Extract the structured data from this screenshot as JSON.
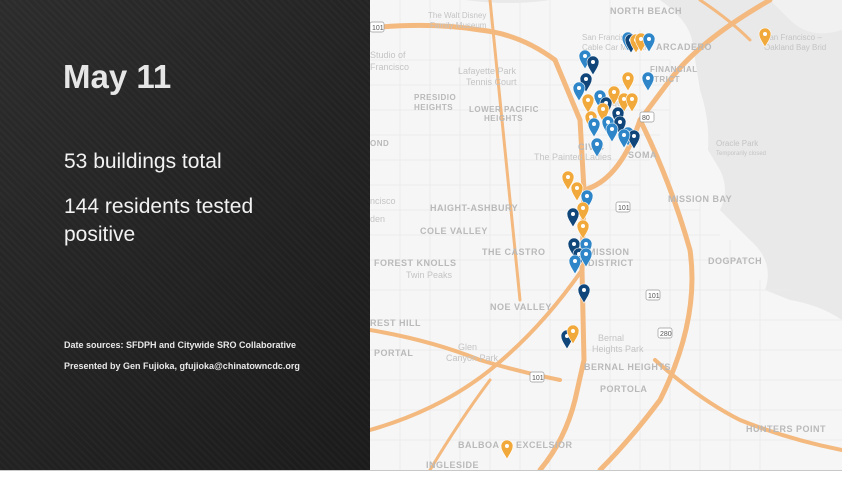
{
  "slide": {
    "title": "May 11",
    "stat_buildings": "53 buildings total",
    "stat_residents": "144 residents tested positive",
    "data_sources": "Date sources: SFDPH and Citywide SRO Collaborative",
    "presenter": "Presented by Gen Fujioka, gfujioka@chinatowncdc.org"
  },
  "map": {
    "labels": {
      "north_beach": "NORTH BEACH",
      "walt_disney": "The Walt Disney",
      "family_museum": "Family Museum",
      "studio_of": "Studio of",
      "francisco": "Francisco",
      "cable_car_1": "San Francisco",
      "cable_car_2": "Cable Car Museum",
      "embarcadero": "ARCADERO",
      "bay_bridge_1": "San Francisco –",
      "bay_bridge_2": "Oakland Bay Brid",
      "lafayette_1": "Lafayette Park",
      "lafayette_2": "Tennis Court",
      "financial_1": "FINANCIAL",
      "financial_2": "TRICT",
      "presidio_1": "PRESIDIO",
      "presidio_2": "HEIGHTS",
      "lower_pacific_1": "LOWER PACIFIC",
      "lower_pacific_2": "HEIGHTS",
      "square": "quare",
      "ond": "OND",
      "oracle_1": "Oracle Park",
      "oracle_2": "Temporarily closed",
      "civic": "CIVIC",
      "painted_ladies": "The Painted Ladies",
      "soma": "SOMA",
      "ncisco": "ncisco",
      "haight": "HAIGHT-ASHBURY",
      "mission_bay": "MISSION BAY",
      "den": "den",
      "cole_valley": "COLE VALLEY",
      "castro": "THE CASTRO",
      "mission_1": "MISSION",
      "mission_2": "DISTRICT",
      "forest_knolls": "FOREST KNOLLS",
      "twin_peaks": "Twin Peaks",
      "dogpatch": "DOGPATCH",
      "noe_valley": "NOE VALLEY",
      "rest_hill": "REST HILL",
      "glen_1": "Glen",
      "glen_2": "Canyon Park",
      "bernal_1": "Bernal",
      "bernal_2": "Heights Park",
      "portal": "PORTAL",
      "bernal_heights": "BERNAL HEIGHTS",
      "portola": "PORTOLA",
      "hunters_point": "HUNTERS POINT",
      "balboa": "BALBOA P",
      "excelsior": "EXCELSIOR",
      "ingleside": "INGLESIDE",
      "hwy_101a": "101",
      "hwy_101b": "101",
      "hwy_101c": "101",
      "hwy_101d": "101",
      "hwy_280": "280",
      "hwy_80": "80"
    },
    "colors": {
      "water": "#e9e9e9",
      "land": "#f6f6f6",
      "highway": "#f3b97f",
      "marker_orange": "#f2a93b",
      "marker_blue_light": "#2e86c8",
      "marker_blue_dark": "#10467a"
    }
  }
}
